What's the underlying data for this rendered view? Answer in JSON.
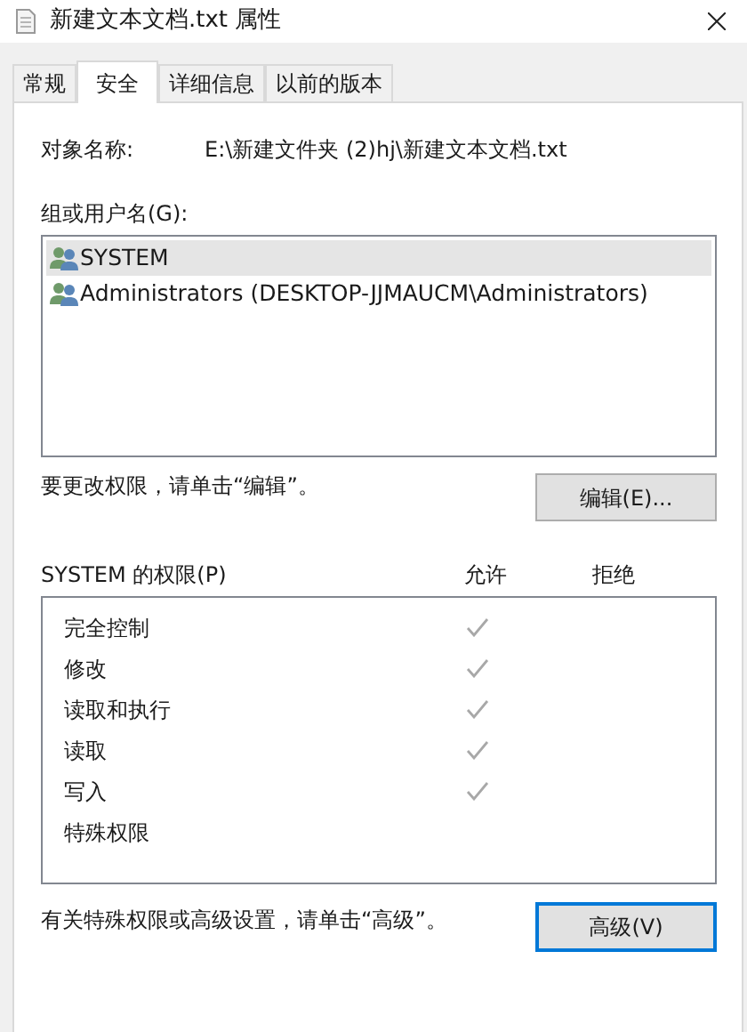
{
  "window": {
    "title": "新建文本文档.txt 属性"
  },
  "tabs": [
    {
      "label": "常规",
      "selected": false
    },
    {
      "label": "安全",
      "selected": true
    },
    {
      "label": "详细信息",
      "selected": false
    },
    {
      "label": "以前的版本",
      "selected": false
    }
  ],
  "object_name": {
    "label": "对象名称:",
    "value": "E:\\新建文件夹 (2)hj\\新建文本文档.txt"
  },
  "groups": {
    "label": "组或用户名(G):",
    "items": [
      {
        "name": "SYSTEM",
        "selected": true
      },
      {
        "name": "Administrators (DESKTOP-JJMAUCM\\Administrators)",
        "selected": false
      }
    ]
  },
  "edit_hint": "要更改权限，请单击“编辑”。",
  "edit_button": {
    "label": "编辑(E)..."
  },
  "permissions": {
    "title": "SYSTEM 的权限(P)",
    "columns": [
      "允许",
      "拒绝"
    ],
    "rows": [
      {
        "name": "完全控制",
        "allow": true
      },
      {
        "name": "修改",
        "allow": true
      },
      {
        "name": "读取和执行",
        "allow": true
      },
      {
        "name": "读取",
        "allow": true
      },
      {
        "name": "写入",
        "allow": true
      },
      {
        "name": "特殊权限",
        "allow": false
      }
    ]
  },
  "advanced_hint": "有关特殊权限或高级设置，请单击“高级”。",
  "advanced_button": {
    "label": "高级(V)",
    "focused": true
  }
}
